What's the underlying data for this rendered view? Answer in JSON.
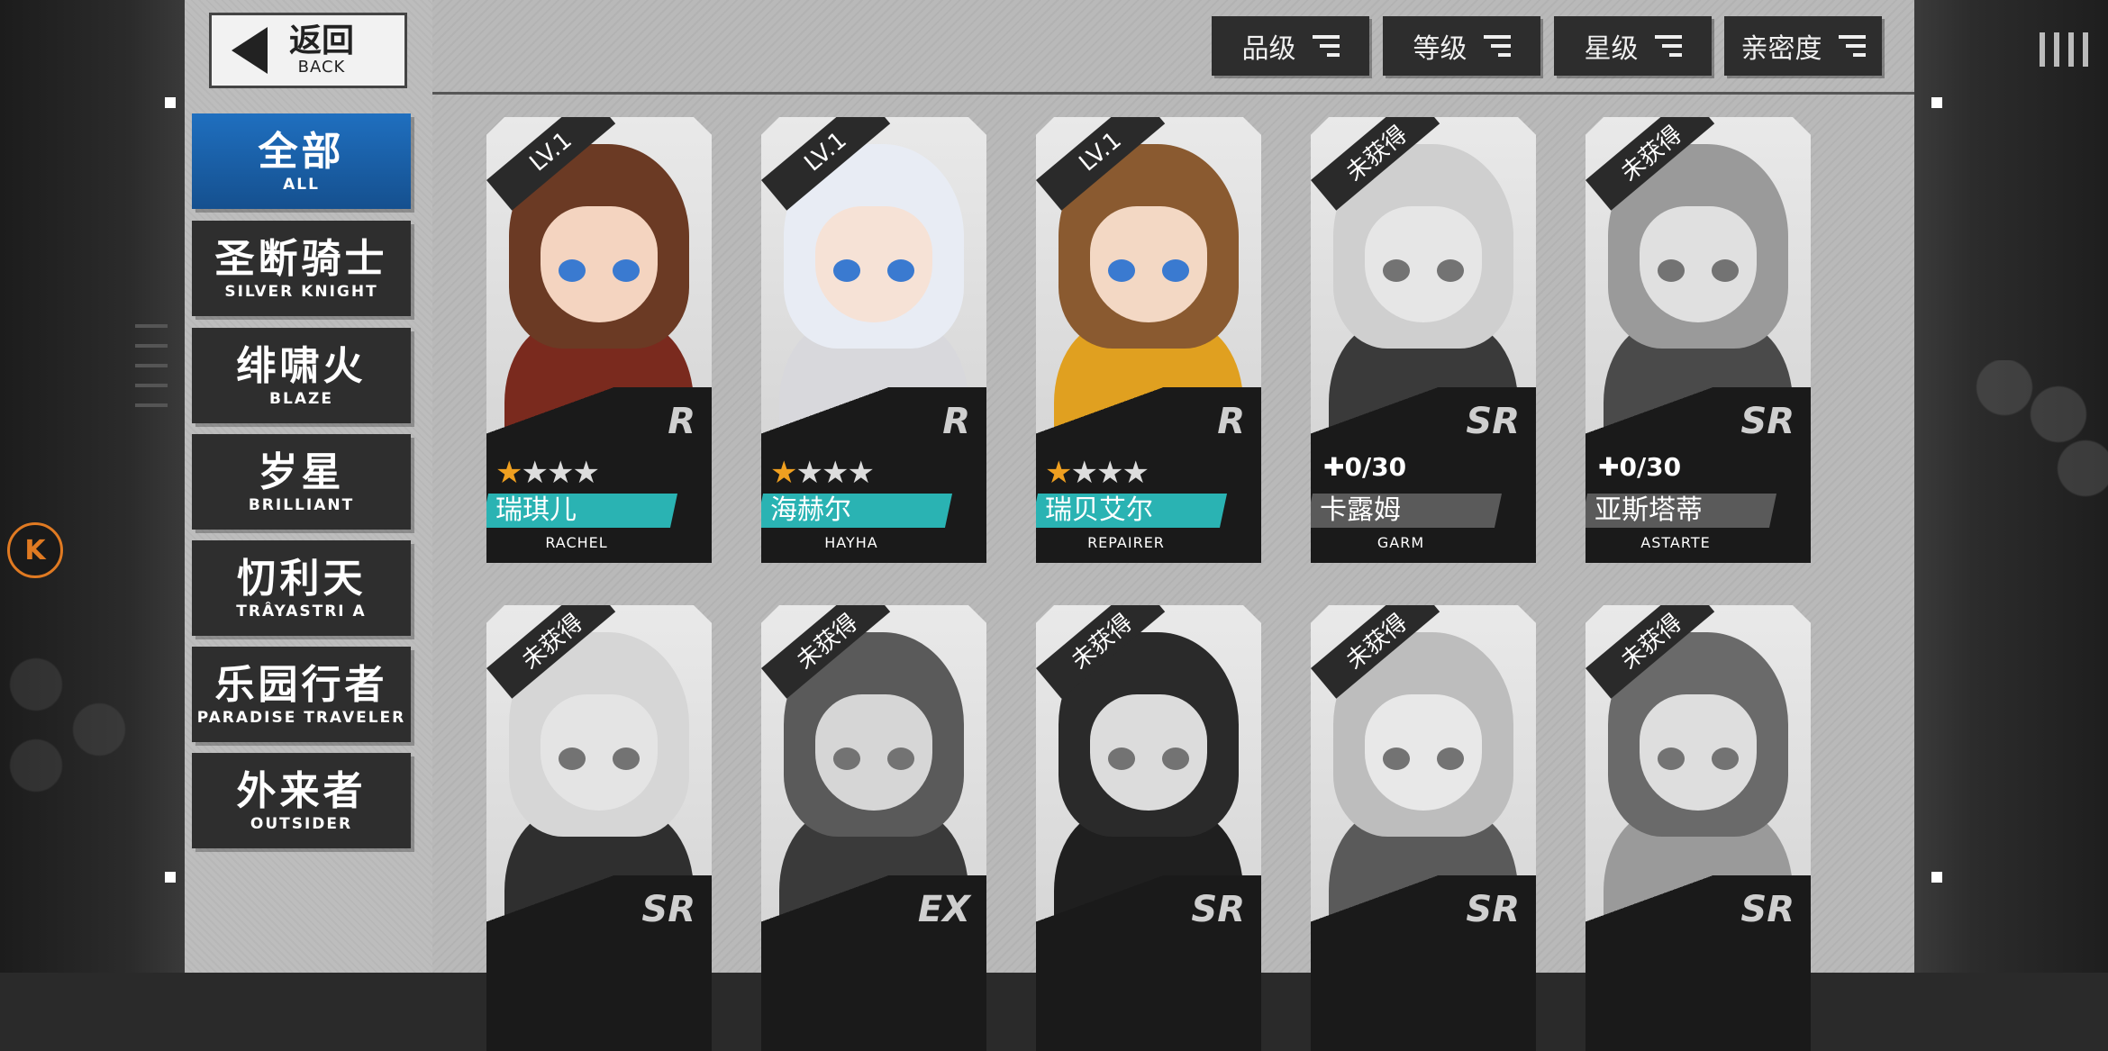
{
  "back": {
    "cn": "返回",
    "en": "BACK"
  },
  "categories": [
    {
      "cn": "全部",
      "en": "ALL"
    },
    {
      "cn": "圣断骑士",
      "en": "SILVER KNIGHT"
    },
    {
      "cn": "绯啸火",
      "en": "BLAZE"
    },
    {
      "cn": "岁星",
      "en": "BRILLIANT"
    },
    {
      "cn": "忉利天",
      "en": "TRÂYASTRI A"
    },
    {
      "cn": "乐园行者",
      "en": "PARADISE TRAVELER"
    },
    {
      "cn": "外来者",
      "en": "OUTSIDER"
    }
  ],
  "sort_buttons": [
    "品级",
    "等级",
    "星级",
    "亲密度"
  ],
  "badge": "K",
  "characters": [
    {
      "name": "瑞琪儿",
      "en": "RACHEL",
      "rarity": "R",
      "tag": "LV.1",
      "stars": 1,
      "owned": true,
      "colors": [
        "#6b3a24",
        "#f4d4c0",
        "#7a2a1e"
      ]
    },
    {
      "name": "海赫尔",
      "en": "HAYHA",
      "rarity": "R",
      "tag": "LV.1",
      "stars": 1,
      "owned": true,
      "colors": [
        "#e8ecf4",
        "#f6e2d6",
        "#d8d8dc"
      ]
    },
    {
      "name": "瑞贝艾尔",
      "en": "REPAIRER",
      "rarity": "R",
      "tag": "LV.1",
      "stars": 1,
      "owned": true,
      "colors": [
        "#8a5a30",
        "#f3d8c4",
        "#e0a020"
      ]
    },
    {
      "name": "卡露姆",
      "en": "GARM",
      "rarity": "SR",
      "tag": "未获得",
      "pieces": "0/30",
      "owned": false,
      "colors": [
        "#cfcfcf",
        "#e6e6e6",
        "#3a3a3a"
      ]
    },
    {
      "name": "亚斯塔蒂",
      "en": "ASTARTE",
      "rarity": "SR",
      "tag": "未获得",
      "pieces": "0/30",
      "owned": false,
      "colors": [
        "#9a9a9a",
        "#e0e0e0",
        "#4a4a4a"
      ]
    },
    {
      "rarity": "SR",
      "tag": "未获得",
      "owned": false,
      "colors": [
        "#d6d6d6",
        "#e4e4e4",
        "#2f2f2f"
      ]
    },
    {
      "rarity": "EX",
      "tag": "未获得",
      "owned": false,
      "colors": [
        "#5a5a5a",
        "#d6d6d6",
        "#3a3a3a"
      ]
    },
    {
      "rarity": "SR",
      "tag": "未获得",
      "owned": false,
      "colors": [
        "#2a2a2a",
        "#dcdcdc",
        "#1f1f1f"
      ]
    },
    {
      "rarity": "SR",
      "tag": "未获得",
      "owned": false,
      "colors": [
        "#bdbdbd",
        "#e8e8e8",
        "#5a5a5a"
      ]
    },
    {
      "rarity": "SR",
      "tag": "未获得",
      "owned": false,
      "colors": [
        "#6a6a6a",
        "#dedede",
        "#9a9a9a"
      ]
    }
  ]
}
